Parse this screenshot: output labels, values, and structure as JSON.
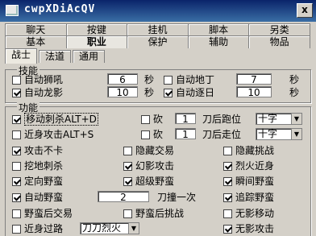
{
  "window": {
    "title": "cwpXDiAcQV",
    "close_label": "x"
  },
  "tabs_row1": [
    "聊天",
    "按键",
    "挂机",
    "脚本",
    "另类"
  ],
  "tabs_row2": [
    "基本",
    "职业",
    "保护",
    "辅助",
    "物品"
  ],
  "subtabs": [
    "战士",
    "法道",
    "通用"
  ],
  "skills": {
    "title": "技能",
    "auto_roar": {
      "label": "自动狮吼",
      "checked": false,
      "value": "6",
      "unit": "秒"
    },
    "auto_ground": {
      "label": "自动地丁",
      "checked": false,
      "value": "7",
      "unit": "秒"
    },
    "auto_dragon": {
      "label": "自动龙影",
      "checked": true,
      "value": "10",
      "unit": "秒"
    },
    "auto_revenge": {
      "label": "自动逐日",
      "checked": true,
      "value": "10",
      "unit": "秒"
    }
  },
  "functions": {
    "title": "功能",
    "move_stab": {
      "label": "移动刺杀ALT+D",
      "checked": true
    },
    "chop1": {
      "label": "砍",
      "checked": false,
      "value": "1",
      "after": "刀后跑位",
      "select": "十字"
    },
    "close_attack": {
      "label": "近身攻击ALT+S",
      "checked": false
    },
    "chop2": {
      "label": "砍",
      "checked": false,
      "value": "1",
      "after": "刀后走位",
      "select": "十字"
    },
    "grid": [
      [
        {
          "label": "攻击不卡",
          "checked": true
        },
        {
          "label": "隐藏交易",
          "checked": false
        },
        {
          "label": "隐藏挑战",
          "checked": false
        }
      ],
      [
        {
          "label": "挖地刺杀",
          "checked": false
        },
        {
          "label": "幻影攻击",
          "checked": true
        },
        {
          "label": "烈火近身",
          "checked": true
        }
      ],
      [
        {
          "label": "定向野蛮",
          "checked": true
        },
        {
          "label": "超级野蛮",
          "checked": true
        },
        {
          "label": "瞬间野蛮",
          "checked": true
        }
      ]
    ],
    "auto_barbarian": {
      "label": "自动野蛮",
      "checked": true,
      "value": "2",
      "after": "刀撞一次"
    },
    "trace_barbarian": {
      "label": "追踪野蛮",
      "checked": true
    },
    "row8": [
      {
        "label": "野蛮后交易",
        "checked": false
      },
      {
        "label": "野蛮后挑战",
        "checked": false
      },
      {
        "label": "无影移动",
        "checked": false
      }
    ],
    "row9": {
      "label": "近身过路",
      "checked": false,
      "select": "刀刀烈火"
    },
    "row9_right": {
      "label": "无影攻击",
      "checked": true
    }
  }
}
